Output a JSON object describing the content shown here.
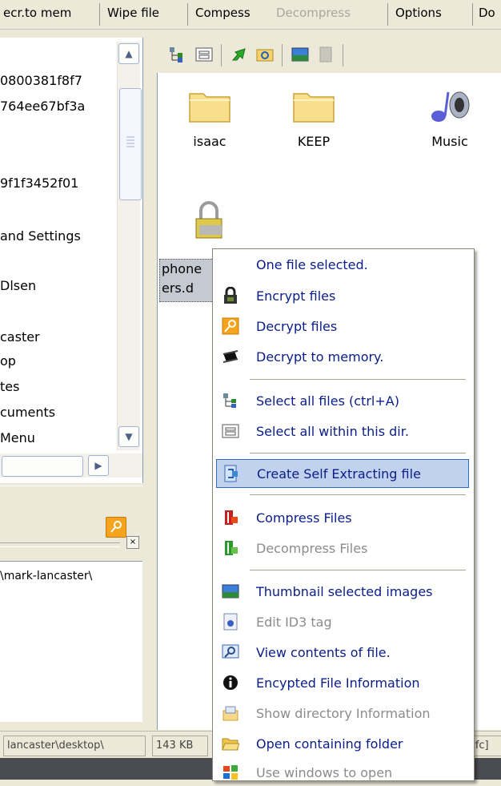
{
  "menubar": {
    "items": [
      {
        "label": "ecr.to mem",
        "disabled": false
      },
      {
        "label": "Wipe file",
        "disabled": false
      },
      {
        "label": "Compess",
        "disabled": false
      },
      {
        "label": "Decompress",
        "disabled": true
      },
      {
        "label": "Options",
        "disabled": false
      },
      {
        "label": "Do",
        "disabled": false
      }
    ]
  },
  "tree": {
    "lines": [
      "0800381f8f7",
      "764ee67bf3a",
      "9f1f3452f01",
      "and Settings",
      "Dlsen",
      "caster",
      "op",
      "tes",
      "cuments",
      "Menu"
    ]
  },
  "lower_panel": {
    "path_text": "\\mark-lancaster\\"
  },
  "files": [
    {
      "name": "isaac",
      "icon": "folder-icon"
    },
    {
      "name": "KEEP",
      "icon": "folder-icon"
    },
    {
      "name": "Music",
      "icon": "music-note-icon"
    },
    {
      "name_line1": "phone",
      "name_line2": "ers.d",
      "icon": "padlock-icon"
    }
  ],
  "status": {
    "path": "lancaster\\desktop\\",
    "size": "143 KB",
    "right": "zfc]"
  },
  "context_menu": {
    "header": "One file selected.",
    "items": [
      {
        "label": "Encrypt files",
        "icon": "lock-encrypt-icon",
        "disabled": false
      },
      {
        "label": "Decrypt files",
        "icon": "key-decrypt-icon",
        "disabled": false
      },
      {
        "label": "Decrypt to memory.",
        "icon": "memory-chip-icon",
        "disabled": false
      },
      {
        "label": "Select all files (ctrl+A)",
        "icon": "select-all-icon",
        "disabled": false
      },
      {
        "label": "Select all within this dir.",
        "icon": "select-dir-icon",
        "disabled": false
      },
      {
        "label": "Create Self Extracting file",
        "icon": "self-extract-icon",
        "disabled": false,
        "highlighted": true
      },
      {
        "label": "Compress Files",
        "icon": "compress-icon",
        "disabled": false
      },
      {
        "label": "Decompress Files",
        "icon": "decompress-icon",
        "disabled": true
      },
      {
        "label": "Thumbnail selected images",
        "icon": "thumbnail-icon",
        "disabled": false
      },
      {
        "label": "Edit ID3 tag",
        "icon": "id3-tag-icon",
        "disabled": true
      },
      {
        "label": "View contents of file.",
        "icon": "view-contents-icon",
        "disabled": false
      },
      {
        "label": "Encypted File Information",
        "icon": "info-icon",
        "disabled": false
      },
      {
        "label": "Show directory Information",
        "icon": "directory-info-icon",
        "disabled": true
      },
      {
        "label": "Open containing folder",
        "icon": "open-folder-icon",
        "disabled": false
      },
      {
        "label": "Use windows to open",
        "icon": "windows-icon",
        "disabled": true
      }
    ]
  },
  "colors": {
    "menu_text": "#0a1d88",
    "highlight_bg": "#c1d2ee",
    "highlight_border": "#316ac5",
    "disabled_text": "#8b8b8b"
  }
}
